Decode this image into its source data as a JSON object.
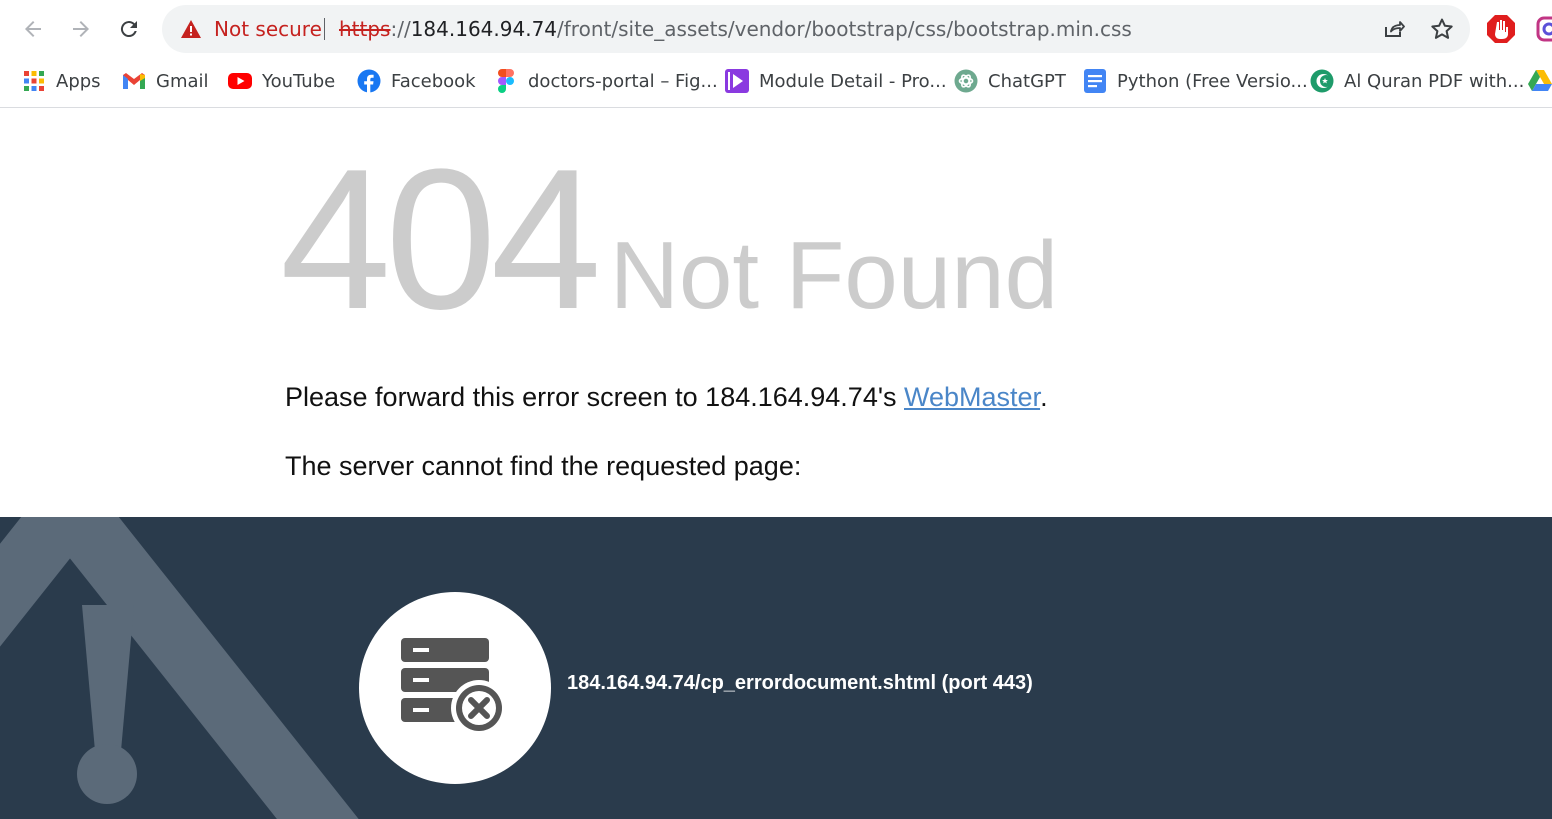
{
  "browser": {
    "security_label": "Not secure",
    "url": {
      "scheme": "https",
      "separator": "://",
      "host": "184.164.94.74",
      "path": "/front/site_assets/vendor/bootstrap/css/bootstrap.min.css"
    },
    "icons": [
      "back-icon",
      "forward-icon",
      "reload-icon",
      "warning-triangle-icon",
      "share-icon",
      "star-icon",
      "extension-stop-icon",
      "extension-instagram-icon"
    ]
  },
  "bookmarks": [
    {
      "label": "Apps",
      "icon": "apps-grid-icon"
    },
    {
      "label": "Gmail",
      "icon": "gmail-icon"
    },
    {
      "label": "YouTube",
      "icon": "youtube-icon"
    },
    {
      "label": "Facebook",
      "icon": "facebook-icon"
    },
    {
      "label": "doctors-portal – Fig...",
      "icon": "figma-icon"
    },
    {
      "label": "Module Detail - Pro...",
      "icon": "module-play-icon"
    },
    {
      "label": "ChatGPT",
      "icon": "chatgpt-icon"
    },
    {
      "label": "Python (Free Versio...",
      "icon": "docs-icon"
    },
    {
      "label": "Al Quran PDF with...",
      "icon": "quran-icon"
    }
  ],
  "page": {
    "error_code": "404",
    "error_title": "Not Found",
    "forward_prefix": "Please forward this error screen to 184.164.94.74's ",
    "webmaster_link": "WebMaster",
    "forward_suffix": ".",
    "cannot_find": "The server cannot find the requested page:",
    "requested_page": "184.164.94.74/cp_errordocument.shtml (port 443)"
  },
  "colors": {
    "error_gray": "#cccccc",
    "link": "#4a86c8",
    "footer_bg": "#2a3b4c",
    "not_secure_red": "#c5221f"
  }
}
